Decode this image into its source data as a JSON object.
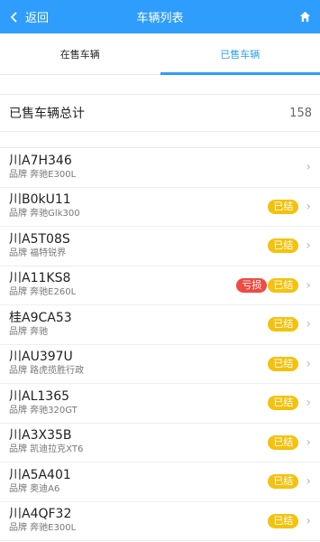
{
  "header": {
    "back_label": "返回",
    "title": "车辆列表",
    "home_icon": "home-icon"
  },
  "tabs": [
    {
      "label": "在售车辆",
      "active": false
    },
    {
      "label": "已售车辆",
      "active": true
    }
  ],
  "summary": {
    "label": "已售车辆总计",
    "count": "158"
  },
  "vehicles": [
    {
      "plate": "川A7H346",
      "brand": "品牌 奔驰E300L",
      "badges": []
    },
    {
      "plate": "川B0kU11",
      "brand": "品牌 奔驰Glk300",
      "badges": [
        "已结"
      ]
    },
    {
      "plate": "川A5T08S",
      "brand": "品牌 福特锐界",
      "badges": [
        "已结"
      ]
    },
    {
      "plate": "川A11KS8",
      "brand": "品牌 奔驰E260L",
      "badges": [
        "亏损",
        "已结"
      ]
    },
    {
      "plate": "桂A9CA53",
      "brand": "品牌 奔驰",
      "badges": [
        "已结"
      ]
    },
    {
      "plate": "川AU397U",
      "brand": "品牌 路虎揽胜行政",
      "badges": [
        "已结"
      ]
    },
    {
      "plate": "川AL1365",
      "brand": "品牌 奔驰320GT",
      "badges": [
        "已结"
      ]
    },
    {
      "plate": "川A3X35B",
      "brand": "品牌 凯迪拉克XT6",
      "badges": [
        "已结"
      ]
    },
    {
      "plate": "川A5A401",
      "brand": "品牌 奥迪A6",
      "badges": [
        "已结"
      ]
    },
    {
      "plate": "川A4QF32",
      "brand": "品牌 奔驰E300L",
      "badges": [
        "已结"
      ]
    }
  ],
  "colors": {
    "accent": "#2f9dfb",
    "settled": "#f4c20d",
    "loss": "#ee4b43"
  }
}
